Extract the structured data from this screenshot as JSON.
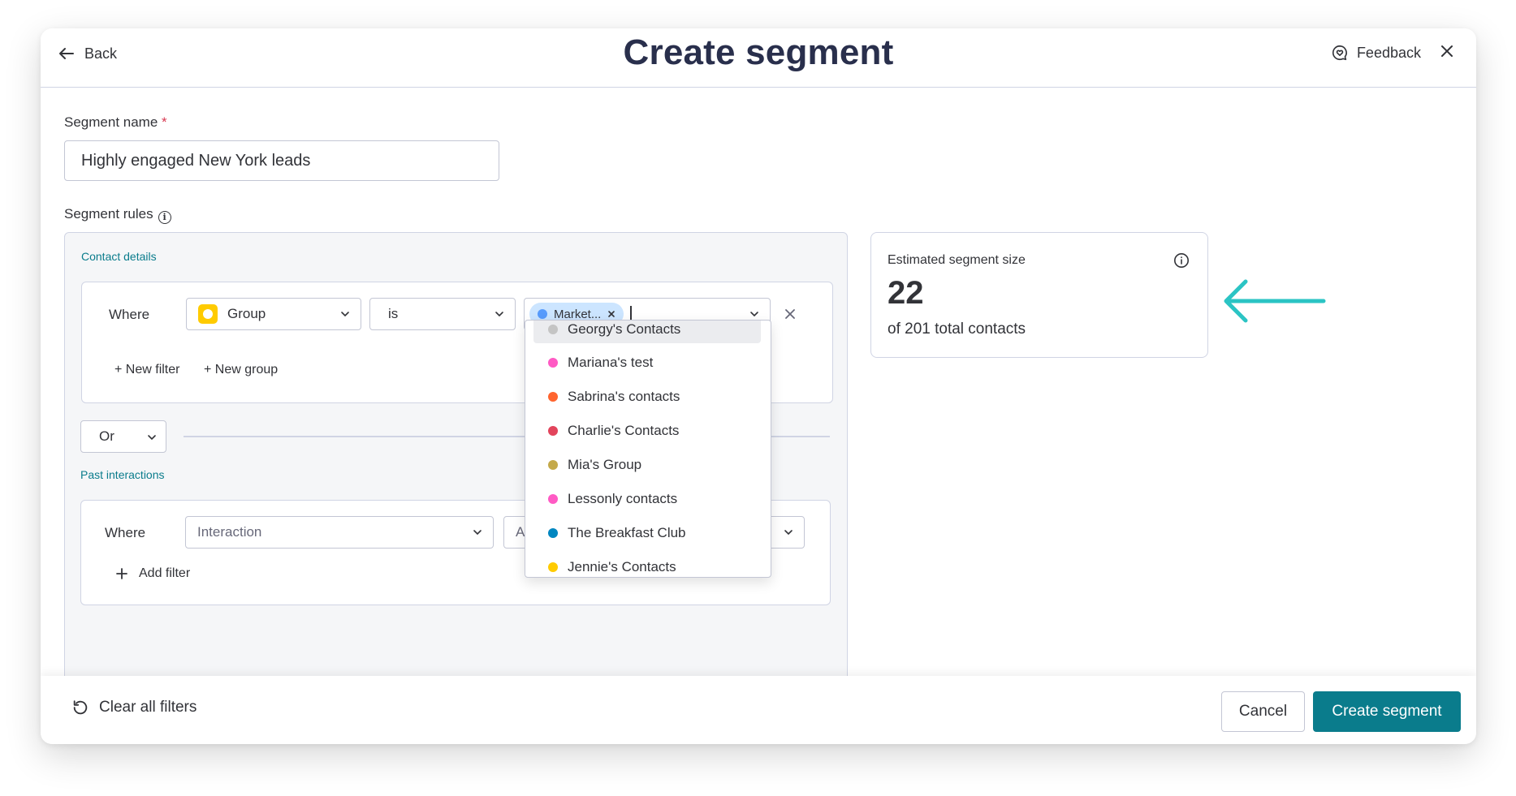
{
  "header": {
    "back_label": "Back",
    "title": "Create segment",
    "feedback_label": "Feedback"
  },
  "form": {
    "segment_name_label": "Segment name",
    "required_marker": "*",
    "segment_name_value": "Highly engaged New York leads",
    "segment_rules_label": "Segment rules"
  },
  "contact_details": {
    "section_title": "Contact details",
    "where_label": "Where",
    "field_select": "Group",
    "operator_select": "is",
    "selected_tag": "Market...",
    "new_filter": "+ New filter",
    "new_group": "+ New group"
  },
  "conjunction": "Or",
  "past_interactions": {
    "section_title": "Past interactions",
    "where_label": "Where",
    "field_select": "Interaction",
    "operator_partial": "A",
    "add_filter": "Add filter"
  },
  "dropdown": {
    "items": [
      {
        "label": "Georgy's Contacts",
        "color": "#c4c4c4",
        "hovered": true
      },
      {
        "label": "Mariana's test",
        "color": "#ff5ac4"
      },
      {
        "label": "Sabrina's contacts",
        "color": "#ff642e"
      },
      {
        "label": "Charlie's Contacts",
        "color": "#e2445c"
      },
      {
        "label": "Mia's Group",
        "color": "#c4a94a"
      },
      {
        "label": "Lessonly contacts",
        "color": "#ff5ac4"
      },
      {
        "label": "The Breakfast Club",
        "color": "#0086c0"
      },
      {
        "label": "Jennie's Contacts",
        "color": "#ffcb00"
      }
    ]
  },
  "estimate": {
    "label": "Estimated segment size",
    "value": "22",
    "subtext": "of 201 total contacts"
  },
  "footer": {
    "clear_label": "Clear all filters",
    "cancel_label": "Cancel",
    "create_label": "Create segment"
  },
  "colors": {
    "accent": "#0a7c8c",
    "arrow": "#2bc4c4",
    "group_icon": "#ffcb00",
    "tag_bg": "#cce5ff"
  }
}
